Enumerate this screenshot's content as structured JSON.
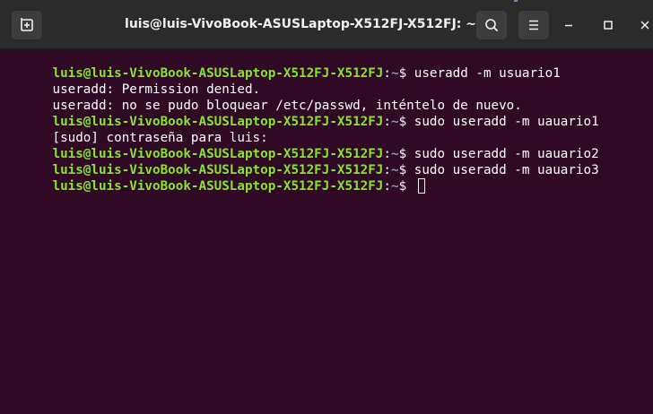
{
  "window": {
    "title": "luis@luis-VivoBook-ASUSLaptop-X512FJ-X512FJ: ~"
  },
  "icons": {
    "new_tab": "new-tab-icon",
    "search": "search-icon",
    "menu": "hamburger-menu-icon",
    "minimize": "minimize-icon",
    "maximize": "maximize-icon",
    "close": "close-icon"
  },
  "colors": {
    "background": "#300a24",
    "titlebar": "#2b2b2b",
    "prompt_user": "#8ae234",
    "prompt_path": "#729fcf",
    "text": "#ffffff"
  },
  "terminal": {
    "lines": [
      {
        "type": "prompt",
        "user": "luis@luis-VivoBook-ASUSLaptop-X512FJ-X512FJ",
        "sep": ":",
        "path": "~",
        "symbol": "$ ",
        "command": "useradd -m usuario1"
      },
      {
        "type": "output",
        "text": "useradd: Permission denied."
      },
      {
        "type": "output",
        "text": "useradd: no se pudo bloquear /etc/passwd, inténtelo de nuevo."
      },
      {
        "type": "prompt",
        "user": "luis@luis-VivoBook-ASUSLaptop-X512FJ-X512FJ",
        "sep": ":",
        "path": "~",
        "symbol": "$ ",
        "command": "sudo useradd -m uauario1"
      },
      {
        "type": "output",
        "text": "[sudo] contraseña para luis:"
      },
      {
        "type": "prompt",
        "user": "luis@luis-VivoBook-ASUSLaptop-X512FJ-X512FJ",
        "sep": ":",
        "path": "~",
        "symbol": "$ ",
        "command": "sudo useradd -m uauario2"
      },
      {
        "type": "prompt",
        "user": "luis@luis-VivoBook-ASUSLaptop-X512FJ-X512FJ",
        "sep": ":",
        "path": "~",
        "symbol": "$ ",
        "command": "sudo useradd -m uauario3"
      },
      {
        "type": "prompt",
        "user": "luis@luis-VivoBook-ASUSLaptop-X512FJ-X512FJ",
        "sep": ":",
        "path": "~",
        "symbol": "$ ",
        "command": ""
      }
    ]
  }
}
